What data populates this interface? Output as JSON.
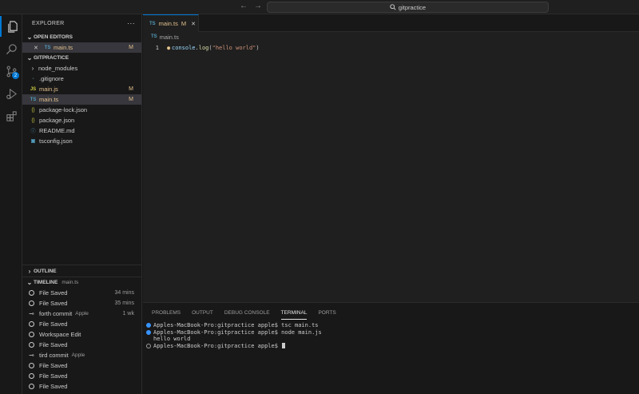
{
  "titlebar": {
    "back": "←",
    "forward": "→",
    "search_text": "gitpractice"
  },
  "activity": {
    "scm_badge": "2"
  },
  "explorer": {
    "title": "EXPLORER",
    "more": "···",
    "open_editors": {
      "label": "OPEN EDITORS",
      "items": [
        {
          "close": "✕",
          "icon": "TS",
          "name": "main.ts",
          "status": "M"
        }
      ]
    },
    "workspace": {
      "label": "GITPRACTICE",
      "folder": "node_modules",
      "files": [
        {
          "icon": "",
          "name": ".gitignore",
          "status": ""
        },
        {
          "icon": "JS",
          "name": "main.js",
          "status": "M"
        },
        {
          "icon": "TS",
          "name": "main.ts",
          "status": "M"
        },
        {
          "icon": "{}",
          "name": "package-lock.json",
          "status": ""
        },
        {
          "icon": "{}",
          "name": "package.json",
          "status": ""
        },
        {
          "icon": "ⓘ",
          "name": "README.md",
          "status": ""
        },
        {
          "icon": "",
          "name": "tsconfig.json",
          "status": ""
        }
      ]
    },
    "outline_label": "OUTLINE",
    "timeline": {
      "label": "TIMELINE",
      "file": "main.ts",
      "items": [
        {
          "label": "File Saved",
          "author": "",
          "time": "34 mins"
        },
        {
          "label": "File Saved",
          "author": "",
          "time": "35 mins"
        },
        {
          "label": "forth commit",
          "author": "Apple",
          "time": "1 wk"
        },
        {
          "label": "File Saved",
          "author": "",
          "time": ""
        },
        {
          "label": "Workspace Edit",
          "author": "",
          "time": ""
        },
        {
          "label": "File Saved",
          "author": "",
          "time": ""
        },
        {
          "label": "tird commit",
          "author": "Apple",
          "time": ""
        },
        {
          "label": "File Saved",
          "author": "",
          "time": ""
        },
        {
          "label": "File Saved",
          "author": "",
          "time": ""
        },
        {
          "label": "File Saved",
          "author": "",
          "time": ""
        }
      ]
    }
  },
  "editor": {
    "tab": {
      "icon": "TS",
      "name": "main.ts",
      "status": "M",
      "close": "✕"
    },
    "breadcrumb": {
      "icon": "TS",
      "name": "main.ts"
    },
    "line_number": "1",
    "code": {
      "object": "console",
      "dot": ".",
      "method": "log",
      "open": "(",
      "string": "\"hello world\"",
      "close": ")"
    }
  },
  "panel": {
    "tabs": [
      "PROBLEMS",
      "OUTPUT",
      "DEBUG CONSOLE",
      "TERMINAL",
      "PORTS"
    ],
    "active_tab": "TERMINAL",
    "terminal": [
      "Apples-MacBook-Pro:gitpractice apple$ tsc main.ts",
      "Apples-MacBook-Pro:gitpractice apple$ node main.js",
      "hello world",
      "Apples-MacBook-Pro:gitpractice apple$ "
    ]
  },
  "colors": {
    "accent": "#0078d4",
    "modified": "#e2c08d",
    "ts": "#519aba",
    "js": "#cbcb41"
  }
}
